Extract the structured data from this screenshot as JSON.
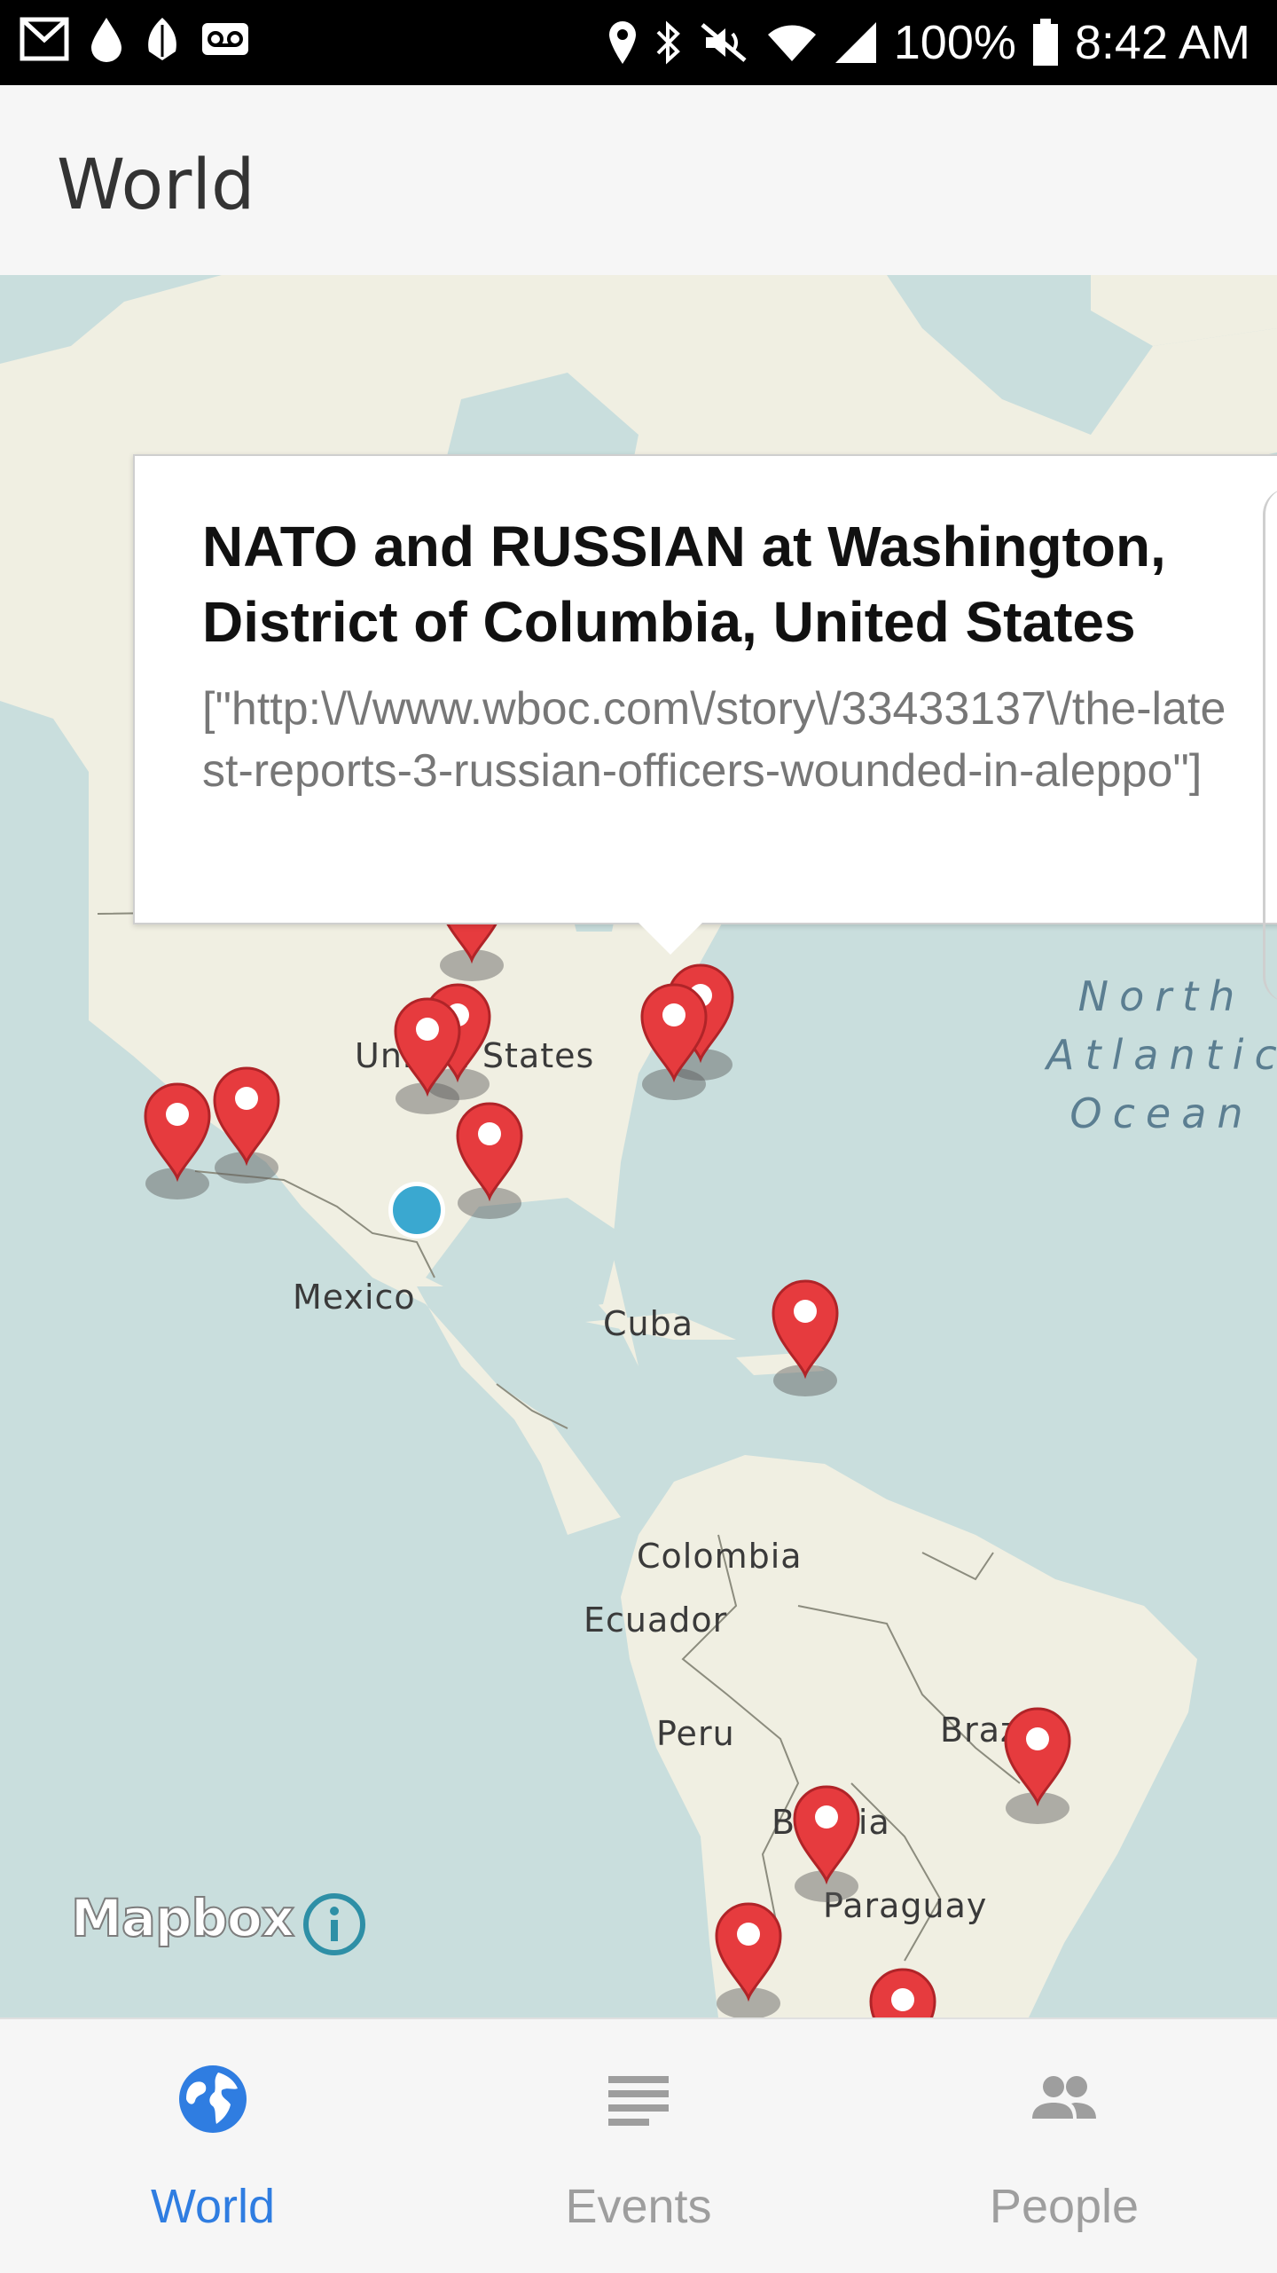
{
  "status_bar": {
    "battery": "100%",
    "time": "8:42 AM",
    "left_icons": [
      "gmail-icon",
      "drop-icon",
      "leaf-icon",
      "voicemail-icon"
    ],
    "right_icons": [
      "location-icon",
      "bluetooth-icon",
      "mute-icon",
      "wifi-icon",
      "signal-icon",
      "battery-icon"
    ]
  },
  "app_bar": {
    "title": "World"
  },
  "map": {
    "labels": {
      "united_states": "United States",
      "mexico": "Mexico",
      "cuba": "Cuba",
      "colombia": "Colombia",
      "ecuador": "Ecuador",
      "peru": "Peru",
      "brazil": "Brazil",
      "bolivia": "Bolivia",
      "paraguay": "Paraguay",
      "ocean": "North\nAtlantic\nOcean"
    },
    "attribution": "Mapbox",
    "colors": {
      "water": "#c9dedd",
      "land": "#f0efe2",
      "marker": "#e63b3e",
      "user_location": "#3aa8d0"
    }
  },
  "callout": {
    "title": "NATO and RUSSIAN at Washington, District of Columbia, United States",
    "body": "[\"http:\\/\\/www.wboc.com\\/story\\/33433137\\/the-latest-reports-3-russian-officers-wounded-in-aleppo\"]"
  },
  "bottom_nav": {
    "items": [
      {
        "label": "World",
        "icon": "globe-icon",
        "active": true
      },
      {
        "label": "Events",
        "icon": "list-icon",
        "active": false
      },
      {
        "label": "People",
        "icon": "people-icon",
        "active": false
      }
    ],
    "active_color": "#2f7de1",
    "inactive_color": "#9e9e9e"
  }
}
